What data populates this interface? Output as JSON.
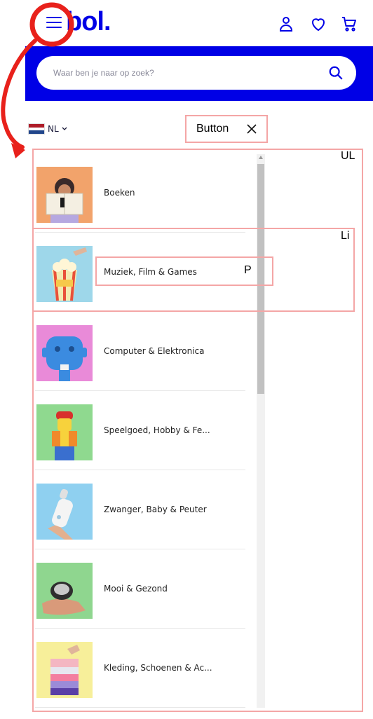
{
  "header": {
    "logo": "bol.",
    "brand_color": "#0000e6"
  },
  "search": {
    "placeholder": "Waar ben je naar op zoek?"
  },
  "language": {
    "code": "NL"
  },
  "annotations": {
    "ul": "UL",
    "li": "Li",
    "p": "P",
    "button": "Button",
    "annotation_color": "#f4a6a6",
    "arrow_color": "#e8211b"
  },
  "categories": [
    {
      "label": "Boeken",
      "icon": "book-reader-photo"
    },
    {
      "label": "Muziek, Film & Games",
      "icon": "popcorn-photo"
    },
    {
      "label": "Computer & Elektronica",
      "icon": "robot-head-photo"
    },
    {
      "label": "Speelgoed, Hobby & Fe...",
      "icon": "lego-figure-photo"
    },
    {
      "label": "Zwanger, Baby & Peuter",
      "icon": "baby-bottle-photo"
    },
    {
      "label": "Mooi & Gezond",
      "icon": "jar-in-hand-photo"
    },
    {
      "label": "Kleding, Schoenen & Ac...",
      "icon": "folded-clothes-photo"
    }
  ]
}
